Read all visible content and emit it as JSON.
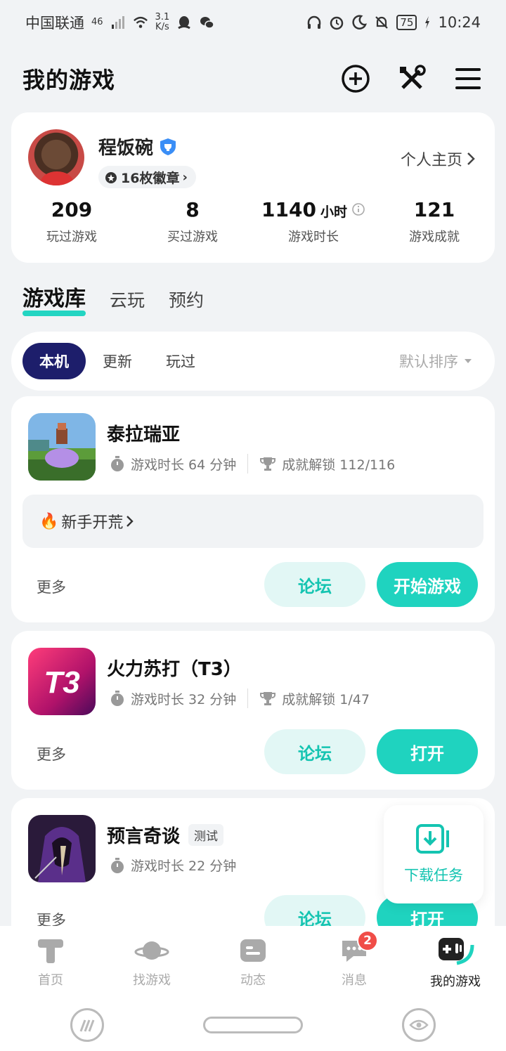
{
  "status_bar": {
    "carrier": "中国联通",
    "network_tag": "46",
    "speed_value": "3.1",
    "speed_unit": "K/s",
    "battery": "75",
    "time": "10:24"
  },
  "header": {
    "title": "我的游戏",
    "icons": [
      "add-icon",
      "tools-icon",
      "menu-icon"
    ]
  },
  "profile": {
    "username": "程饭碗",
    "badge_text": "16枚徽章",
    "homepage_link": "个人主页",
    "stats": [
      {
        "value": "209",
        "unit": "",
        "label": "玩过游戏"
      },
      {
        "value": "8",
        "unit": "",
        "label": "买过游戏"
      },
      {
        "value": "1140",
        "unit": "小时",
        "label": "游戏时长"
      },
      {
        "value": "121",
        "unit": "",
        "label": "游戏成就"
      }
    ]
  },
  "library_tabs": [
    "游戏库",
    "云玩",
    "预约"
  ],
  "filters": {
    "chips": [
      "本机",
      "更新",
      "玩过"
    ],
    "sort": "默认排序"
  },
  "games": [
    {
      "name": "泰拉瑞亚",
      "tag": "",
      "playtime": "游戏时长 64 分钟",
      "achievements": "成就解锁 112/116",
      "guide": "新手开荒",
      "more": "更多",
      "forum": "论坛",
      "action": "开始游戏"
    },
    {
      "name": "火力苏打（T3）",
      "tag": "",
      "icon_text": "T3",
      "playtime": "游戏时长 32 分钟",
      "achievements": "成就解锁 1/47",
      "more": "更多",
      "forum": "论坛",
      "action": "打开"
    },
    {
      "name": "预言奇谈",
      "tag": "测试",
      "playtime": "游戏时长 22 分钟",
      "more": "更多",
      "forum": "论坛",
      "action": "打开"
    }
  ],
  "download_float": {
    "label": "下载任务"
  },
  "bottom_nav": [
    {
      "label": "首页",
      "badge": ""
    },
    {
      "label": "找游戏",
      "badge": ""
    },
    {
      "label": "动态",
      "badge": ""
    },
    {
      "label": "消息",
      "badge": "2"
    },
    {
      "label": "我的游戏",
      "badge": ""
    }
  ],
  "colors": {
    "accent": "#1fd3bf",
    "accent_light": "#e2f7f5",
    "chip_active": "#1d1e6b",
    "badge_red": "#f04d48"
  }
}
